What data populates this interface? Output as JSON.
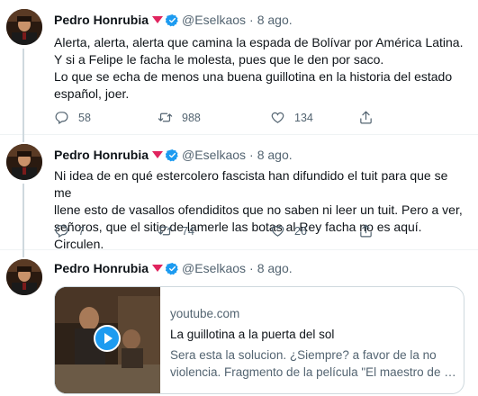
{
  "tweets": [
    {
      "author": {
        "name": "Pedro Honrubia",
        "handle": "@Eselkaos",
        "verified": true,
        "emoji": "heart-icon"
      },
      "time": "8 ago.",
      "lines": [
        "Alerta, alerta, alerta que camina la espada de Bolívar por América Latina.",
        "Y si a Felipe le facha le molesta, pues que le den por saco.",
        "Lo que se echa de menos una buena guillotina en la historia del estado",
        "español, joer."
      ],
      "replies": "58",
      "retweets": "988",
      "likes": "134"
    },
    {
      "author": {
        "name": "Pedro Honrubia",
        "handle": "@Eselkaos",
        "verified": true,
        "emoji": "heart-icon"
      },
      "time": "8 ago.",
      "lines": [
        "Ni idea de en qué estercolero fascista han difundido el tuit para que se me",
        "llene esto de vasallos ofendiditos que no saben ni leer un tuit. Pero a ver,",
        "señoros, que el sitio de lamerle las botas al Rey facha no es aquí. Circulen."
      ],
      "replies": "7",
      "retweets": "74",
      "likes": "26"
    },
    {
      "author": {
        "name": "Pedro Honrubia",
        "handle": "@Eselkaos",
        "verified": true,
        "emoji": "heart-icon"
      },
      "time": "8 ago.",
      "card": {
        "domain": "youtube.com",
        "title": "La guillotina a la puerta del sol",
        "description": "Sera esta la solucion. ¿Siempre? a favor de la no violencia. Fragmento de la película \"El maestro de …"
      }
    }
  ],
  "colors": {
    "verified": "#1d9bf0",
    "heart": "#e0245e",
    "muted": "#536471",
    "text": "#0f1419",
    "play": "#1d9bf0"
  }
}
